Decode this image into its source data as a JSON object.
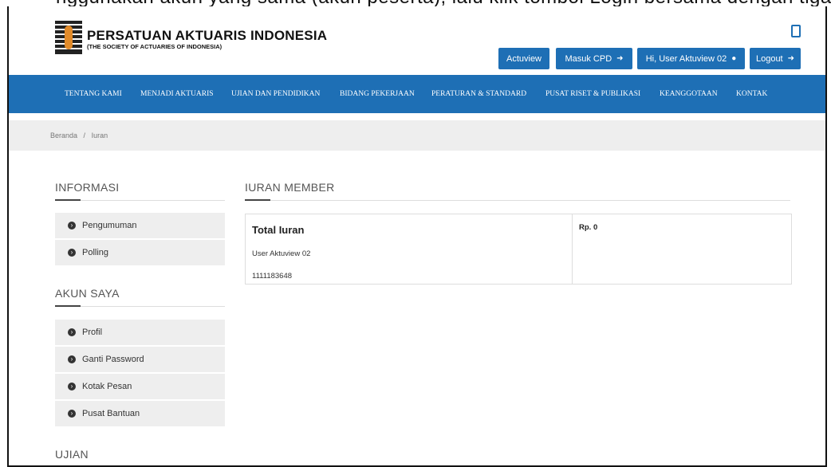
{
  "top_clip": {
    "text": "nggunakan akun yang sama (akun peserta), lalu klik tombol Login bersama dengan tiga"
  },
  "brand": {
    "title": "PERSATUAN AKTUARIS INDONESIA",
    "subtitle": "(THE SOCIETY OF ACTUARIES OF INDONESIA)"
  },
  "header_buttons": {
    "actuview": "Actuview",
    "masuk_cpd": "Masuk CPD",
    "user": "Hi, User Aktuview 02",
    "logout": "Logout"
  },
  "nav": [
    "TENTANG KAMI",
    "MENJADI AKTUARIS",
    "UJIAN DAN PENDIDIKAN",
    "BIDANG PEKERJAAN",
    "PERATURAN & STANDARD",
    "PUSAT RISET & PUBLIKASI",
    "KEANGGOTAAN",
    "KONTAK"
  ],
  "breadcrumb": {
    "home": "Beranda",
    "sep": "/",
    "current": "Iuran"
  },
  "sidebar": {
    "informasi_title": "INFORMASI",
    "informasi_items": [
      "Pengumuman",
      "Polling"
    ],
    "akun_title": "AKUN SAYA",
    "akun_items": [
      "Profil",
      "Ganti Password",
      "Kotak Pesan",
      "Pusat Bantuan"
    ],
    "ujian_title": "UJIAN"
  },
  "main": {
    "title": "IURAN MEMBER",
    "card": {
      "label": "Total Iuran",
      "name": "User Aktuview 02",
      "member_id": "1111183648",
      "amount": "Rp. 0"
    }
  },
  "colors": {
    "primary": "#1e6fb5",
    "light_bg": "#eeeeee"
  }
}
